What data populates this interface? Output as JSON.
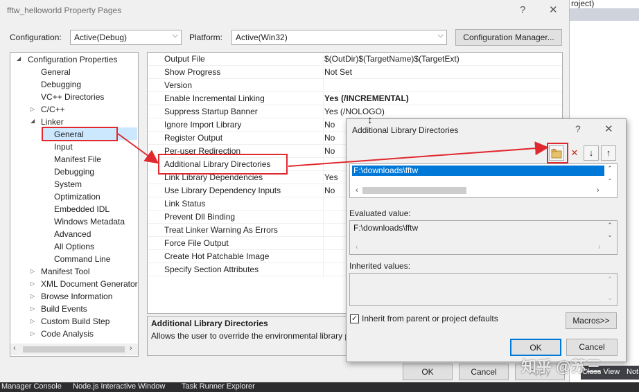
{
  "background": {
    "right_text": "roject)",
    "bottom_tabs": [
      "Manager Console",
      "Node.js Interactive Window",
      "Task Runner Explorer"
    ],
    "right_tabs": [
      "Class View",
      "Not"
    ]
  },
  "main_dialog": {
    "title": "fftw_helloworld Property Pages",
    "help_label": "?",
    "close_label": "✕",
    "configuration_label": "Configuration:",
    "configuration_value": "Active(Debug)",
    "platform_label": "Platform:",
    "platform_value": "Active(Win32)",
    "config_manager_label": "Configuration Manager...",
    "tree": [
      {
        "label": "Configuration Properties",
        "expander": "◢"
      },
      {
        "label": "General"
      },
      {
        "label": "Debugging"
      },
      {
        "label": "VC++ Directories"
      },
      {
        "label": "C/C++",
        "expander": "▷"
      },
      {
        "label": "Linker",
        "expander": "◢"
      },
      {
        "label": "General",
        "selected": true
      },
      {
        "label": "Input"
      },
      {
        "label": "Manifest File"
      },
      {
        "label": "Debugging"
      },
      {
        "label": "System"
      },
      {
        "label": "Optimization"
      },
      {
        "label": "Embedded IDL"
      },
      {
        "label": "Windows Metadata"
      },
      {
        "label": "Advanced"
      },
      {
        "label": "All Options"
      },
      {
        "label": "Command Line"
      },
      {
        "label": "Manifest Tool",
        "expander": "▷"
      },
      {
        "label": "XML Document Generator",
        "expander": "▷"
      },
      {
        "label": "Browse Information",
        "expander": "▷"
      },
      {
        "label": "Build Events",
        "expander": "▷"
      },
      {
        "label": "Custom Build Step",
        "expander": "▷"
      },
      {
        "label": "Code Analysis",
        "expander": "▷"
      }
    ],
    "properties": [
      {
        "name": "Output File",
        "value": "$(OutDir)$(TargetName)$(TargetExt)"
      },
      {
        "name": "Show Progress",
        "value": "Not Set"
      },
      {
        "name": "Version",
        "value": ""
      },
      {
        "name": "Enable Incremental Linking",
        "value": "Yes (/INCREMENTAL)",
        "bold": true
      },
      {
        "name": "Suppress Startup Banner",
        "value": "Yes (/NOLOGO)"
      },
      {
        "name": "Ignore Import Library",
        "value": "No"
      },
      {
        "name": "Register Output",
        "value": "No"
      },
      {
        "name": "Per-user Redirection",
        "value": "No"
      },
      {
        "name": "Additional Library Directories",
        "value": ""
      },
      {
        "name": "Link Library Dependencies",
        "value": "Yes"
      },
      {
        "name": "Use Library Dependency Inputs",
        "value": "No"
      },
      {
        "name": "Link Status",
        "value": ""
      },
      {
        "name": "Prevent Dll Binding",
        "value": ""
      },
      {
        "name": "Treat Linker Warning As Errors",
        "value": ""
      },
      {
        "name": "Force File Output",
        "value": ""
      },
      {
        "name": "Create Hot Patchable Image",
        "value": ""
      },
      {
        "name": "Specify Section Attributes",
        "value": ""
      }
    ],
    "description_title": "Additional Library Directories",
    "description_text": "Allows the user to override the environmental library p",
    "ok_label": "OK",
    "cancel_label": "Cancel",
    "apply_label": "Apply"
  },
  "lib_dialog": {
    "title": "Additional Library Directories",
    "help_label": "?",
    "close_label": "✕",
    "entries": [
      "F:\\downloads\\fftw"
    ],
    "evaluated_label": "Evaluated value:",
    "evaluated_value": "F:\\downloads\\fftw",
    "inherited_label": "Inherited values:",
    "inherit_checkbox_label": "Inherit from parent or project defaults",
    "inherit_checked": true,
    "macros_label": "Macros>>",
    "ok_label": "OK",
    "cancel_label": "Cancel"
  },
  "watermark": "知乎 @苏三",
  "colors": {
    "annotation_red": "#e0282e",
    "selection_blue": "#cce8ff",
    "list_selection": "#0078d7"
  }
}
